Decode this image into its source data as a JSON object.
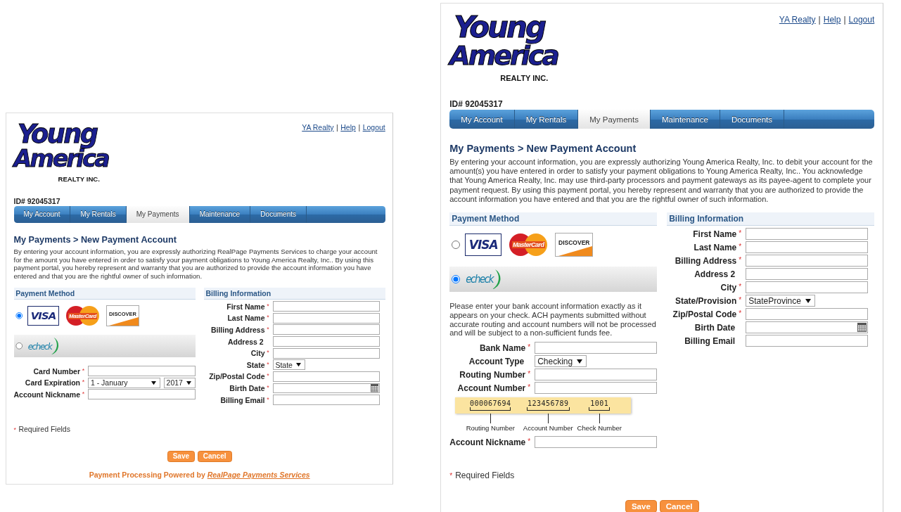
{
  "panels": [
    {
      "logo": {
        "line_1": "Young",
        "line_2": "America",
        "tagline": "REALTY INC."
      },
      "header_links": [
        "YA Realty",
        "Help",
        "Logout"
      ],
      "link_separator": "|",
      "account_id": "ID# 92045317",
      "tabs": [
        {
          "label": "My Account",
          "selected": false
        },
        {
          "label": "My Rentals",
          "selected": false
        },
        {
          "label": "My Payments",
          "selected": true
        },
        {
          "label": "Maintenance",
          "selected": false
        },
        {
          "label": "Documents",
          "selected": false
        }
      ],
      "heading": "My Payments > New Payment Account",
      "disclaimer": "By entering your account information, you are expressly authorizing RealPage Payments Services to charge your account for the amount you have entered in order to satisfy your payment obligations to Young America Realty, Inc.. By using this payment portal, you hereby represent and warranty that you are authorized to provide the account information you have entered and that you are the rightful owner of such information.",
      "payment_method": {
        "title": "Payment Method",
        "options": [
          {
            "kind": "cards",
            "selected": true,
            "logos": [
              {
                "kind": "visa",
                "text": "VISA"
              },
              {
                "kind": "mastercard",
                "text": "MasterCard"
              },
              {
                "kind": "discover",
                "text": "DISCOVER"
              }
            ]
          },
          {
            "kind": "echeck",
            "selected": false,
            "text": "echeck"
          }
        ],
        "fields": [
          {
            "kind": "text",
            "label": "Card Number",
            "required": true
          },
          {
            "kind": "select",
            "label": "Card Expiration",
            "required": true,
            "values": [
              "1 - January",
              "2017"
            ]
          },
          {
            "kind": "text",
            "label": "Account Nickname",
            "required": true
          }
        ]
      },
      "billing": {
        "title": "Billing Information",
        "fields": [
          {
            "kind": "text",
            "label": "First Name",
            "required": true
          },
          {
            "kind": "text",
            "label": "Last Name",
            "required": true
          },
          {
            "kind": "text",
            "label": "Billing Address",
            "required": true
          },
          {
            "kind": "text",
            "label": "Address 2",
            "required": false
          },
          {
            "kind": "text",
            "label": "City",
            "required": true
          },
          {
            "kind": "select",
            "label": "State",
            "required": true,
            "values": [
              "State"
            ]
          },
          {
            "kind": "text",
            "label": "Zip/Postal Code",
            "required": true
          },
          {
            "kind": "date",
            "label": "Birth Date",
            "required": true
          },
          {
            "kind": "text",
            "label": "Billing Email",
            "required": true
          }
        ]
      },
      "required_marker": "*",
      "required_note": "Required Fields",
      "buttons": [
        "Save",
        "Cancel"
      ],
      "footer": {
        "text": "Payment Processing Powered by",
        "link": "RealPage Payments Services"
      }
    },
    {
      "logo": {
        "line_1": "Young",
        "line_2": "America",
        "tagline": "REALTY INC."
      },
      "header_links": [
        "YA Realty",
        "Help",
        "Logout"
      ],
      "link_separator": "|",
      "account_id": "ID# 92045317",
      "tabs": [
        {
          "label": "My Account",
          "selected": false
        },
        {
          "label": "My Rentals",
          "selected": false
        },
        {
          "label": "My Payments",
          "selected": true
        },
        {
          "label": "Maintenance",
          "selected": false
        },
        {
          "label": "Documents",
          "selected": false
        }
      ],
      "heading": "My Payments > New Payment Account",
      "disclaimer": "By entering your account information, you are expressly authorizing Young America Realty, Inc. to debit your account for the amount(s) you have entered in order to satisfy your payment obligations to Young America Realty, Inc.. You acknowledge that Young America Realty, Inc. may use third-party processors and payment gateways as its payee-agent to complete your payment request. By using this payment portal, you hereby represent and warranty that you are authorized to provide the account information you have entered and that you are the rightful owner of such information.",
      "payment_method": {
        "title": "Payment Method",
        "options": [
          {
            "kind": "cards",
            "selected": false,
            "logos": [
              {
                "kind": "visa",
                "text": "VISA"
              },
              {
                "kind": "mastercard",
                "text": "MasterCard"
              },
              {
                "kind": "discover",
                "text": "DISCOVER"
              }
            ]
          },
          {
            "kind": "echeck",
            "selected": true,
            "text": "echeck"
          }
        ],
        "note": "Please enter your bank account information exactly as it appears on your check. ACH payments submitted without accurate routing and account numbers will not be processed and will be subject to a non-sufficient funds fee.",
        "fields": [
          {
            "kind": "text",
            "label": "Bank Name",
            "required": true
          },
          {
            "kind": "select",
            "label": "Account Type",
            "required": false,
            "values": [
              "Checking"
            ]
          },
          {
            "kind": "text",
            "label": "Routing Number",
            "required": true
          },
          {
            "kind": "text",
            "label": "Account Number",
            "required": true
          },
          {
            "kind": "check_diagram",
            "parts": [
              {
                "number": "000067694",
                "label": "Routing Number"
              },
              {
                "number": "123456789",
                "label": "Account Number"
              },
              {
                "number": "1001",
                "label": "Check Number"
              }
            ]
          },
          {
            "kind": "text",
            "label": "Account Nickname",
            "required": true
          }
        ]
      },
      "billing": {
        "title": "Billing Information",
        "fields": [
          {
            "kind": "text",
            "label": "First Name",
            "required": true
          },
          {
            "kind": "text",
            "label": "Last Name",
            "required": true
          },
          {
            "kind": "text",
            "label": "Billing Address",
            "required": true
          },
          {
            "kind": "text",
            "label": "Address 2",
            "required": false
          },
          {
            "kind": "text",
            "label": "City",
            "required": true
          },
          {
            "kind": "select",
            "label": "State/Provision",
            "required": true,
            "values": [
              "StateProvince"
            ]
          },
          {
            "kind": "text",
            "label": "Zip/Postal Code",
            "required": true
          },
          {
            "kind": "date",
            "label": "Birth Date",
            "required": false
          },
          {
            "kind": "text",
            "label": "Billing Email",
            "required": false
          }
        ]
      },
      "required_marker": "*",
      "required_note": "Required Fields",
      "buttons": [
        "Save",
        "Cancel"
      ]
    }
  ]
}
